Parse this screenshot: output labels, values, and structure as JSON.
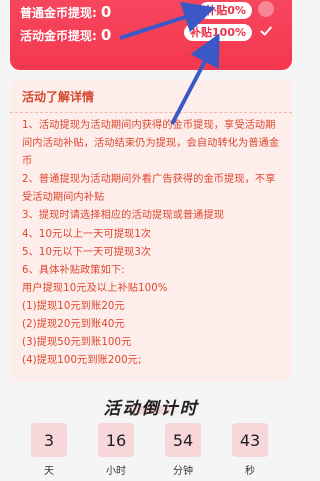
{
  "balance": {
    "normal_label": "普通金币提现:",
    "normal_value": "0",
    "activity_label": "活动金币提现:",
    "activity_value": "0"
  },
  "options": {
    "subsidy_0": "补贴0%",
    "subsidy_100": "补贴100%"
  },
  "info": {
    "title": "活动了解详情",
    "lines": [
      "1、活动提现为活动期间内获得的金币提现，享受活动期间内活动补贴，活动结束仍为提现，会自动转化为普通金币",
      "2、普通提现为活动期间外看广告获得的金币提现，不享受活动期间内补贴",
      "3、提现时请选择相应的活动提现或普通提现",
      "4、10元以上一天可提现1次",
      "5、10元以下一天可提现3次",
      "6、具体补贴政策如下:",
      "用户提现10元及以上补贴100%",
      "(1)提现10元到账20元",
      "(2)提现20元到账40元",
      "(3)提现50元到账100元",
      "(4)提现100元到账200元;"
    ]
  },
  "countdown": {
    "title": "活动倒计时",
    "days": "3",
    "days_label": "天",
    "hours": "16",
    "hours_label": "小时",
    "minutes": "54",
    "minutes_label": "分钟",
    "seconds": "43",
    "seconds_label": "秒"
  },
  "colors": {
    "header_red": "#f4384f",
    "info_bg": "#fdeeec",
    "info_text": "#e0452d",
    "arrow_blue": "#3a59c7"
  },
  "icons": {
    "radio_unchecked": "radio-unchecked-icon",
    "radio_checked": "check-circle-icon",
    "arrow": "annotation-arrow-icon"
  }
}
